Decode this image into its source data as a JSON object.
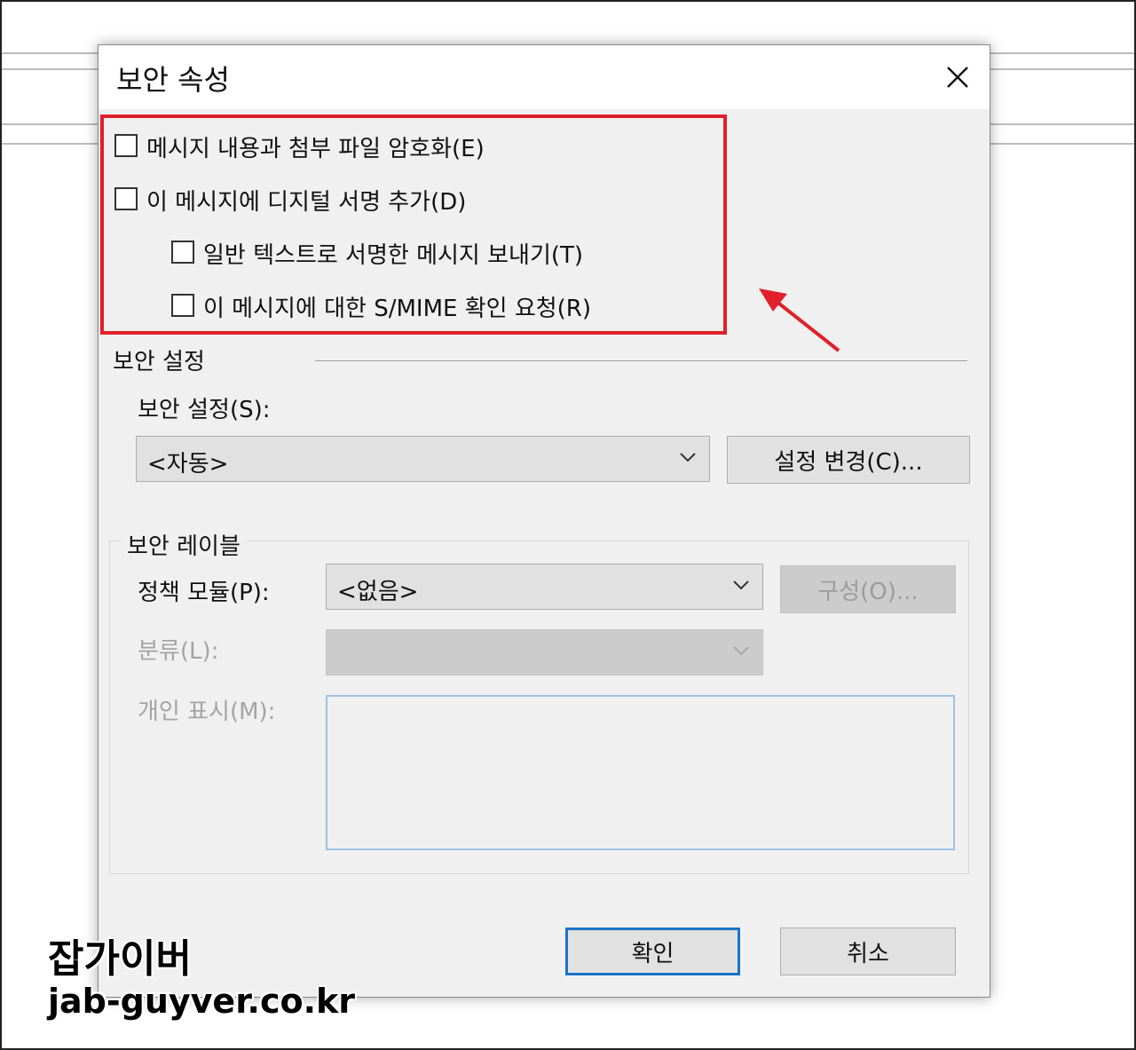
{
  "dialog": {
    "title": "보안 속성",
    "close_icon": "close-icon"
  },
  "options": {
    "encrypt": {
      "label": "메시지 내용과 첨부 파일 암호화(E)",
      "checked": false
    },
    "sign": {
      "label": "이 메시지에 디지털 서명 추가(D)",
      "checked": false
    },
    "clear_text": {
      "label": "일반 텍스트로 서명한 메시지 보내기(T)",
      "checked": false
    },
    "smime_receipt": {
      "label": "이 메시지에 대한 S/MIME 확인 요청(R)",
      "checked": false
    }
  },
  "security_settings": {
    "section_title": "보안 설정",
    "settings_label": "보안 설정(S):",
    "settings_value": "<자동>",
    "change_button": "설정 변경(C)..."
  },
  "security_label": {
    "group_title": "보안 레이블",
    "policy_label": "정책 모듈(P):",
    "policy_value": "<없음>",
    "configure_button": "구성(O)...",
    "classification_label": "분류(L):",
    "classification_value": "",
    "privacy_label": "개인 표시(M):",
    "privacy_value": ""
  },
  "footer": {
    "ok_button": "확인",
    "cancel_button": "취소"
  },
  "watermark": {
    "name": "잡가이버",
    "url": "jab-guyver.co.kr"
  },
  "colors": {
    "highlight": "#e0202a",
    "arrow": "#e0202a",
    "default_button_border": "#1a73c8"
  }
}
